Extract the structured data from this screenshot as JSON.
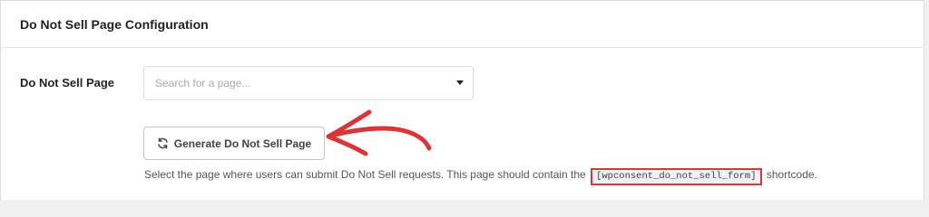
{
  "panel": {
    "title": "Do Not Sell Page Configuration"
  },
  "field": {
    "label": "Do Not Sell Page",
    "select": {
      "placeholder": "Search for a page..."
    }
  },
  "button": {
    "label": "Generate Do Not Sell Page",
    "icon": "refresh-icon"
  },
  "help": {
    "before": "Select the page where users can submit Do Not Sell requests. This page should contain the",
    "shortcode": "[wpconsent_do_not_sell_form]",
    "after": "shortcode."
  },
  "annotation": {
    "arrow_color": "#d9363a",
    "highlight_color": "#d9363a"
  }
}
